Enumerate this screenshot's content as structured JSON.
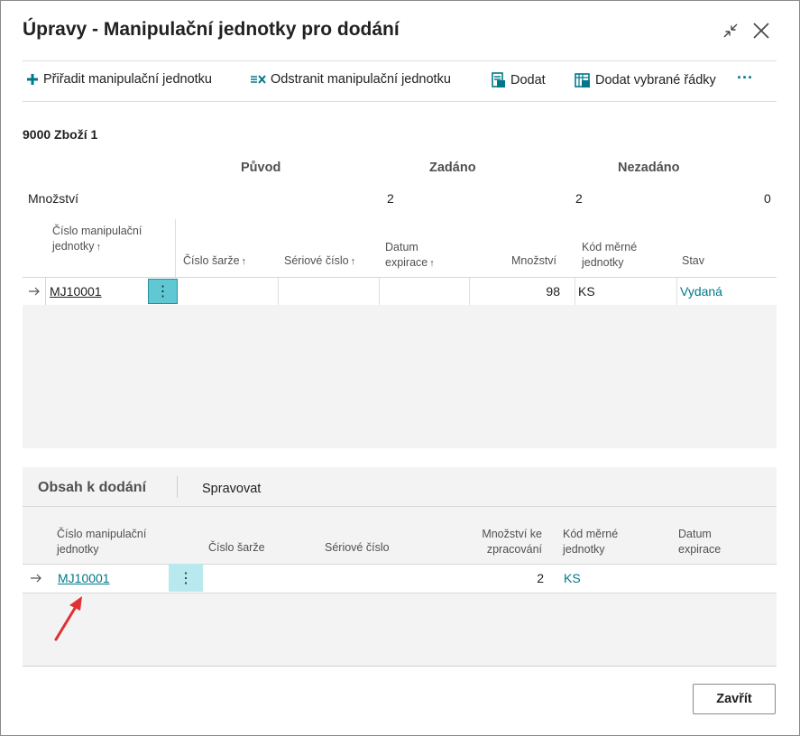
{
  "dialog": {
    "title": "Úpravy - Manipulační jednotky pro dodání"
  },
  "actions": {
    "assign": "Přiřadit manipulační jednotku",
    "remove": "Odstranit manipulační jednotku",
    "deliver": "Dodat",
    "deliver_selected": "Dodat vybrané řádky",
    "more": "···"
  },
  "item_header": "9000 Zboží 1",
  "summary": {
    "headers": [
      "Původ",
      "Zadáno",
      "Nezadáno"
    ],
    "row_label": "Množství",
    "values": [
      "2",
      "2",
      "0"
    ]
  },
  "grid1": {
    "columns": [
      "Číslo manipulační jednotky",
      "Číslo šarže",
      "Sériové číslo",
      "Datum expirace",
      "Množství",
      "Kód měrné jednotky",
      "Stav"
    ],
    "sort_arrow": "↑",
    "rows": [
      {
        "number": "MJ10001",
        "lot": "",
        "serial": "",
        "expiration": "",
        "quantity": "98",
        "uom": "KS",
        "status": "Vydaná"
      }
    ]
  },
  "part": {
    "tab_active": "Obsah k dodání",
    "tab_manage": "Spravovat",
    "columns": [
      "Číslo manipulační jednotky",
      "Číslo šarže",
      "Sériové číslo",
      "Množství ke zpracování",
      "Kód měrné jednotky",
      "Datum expirace"
    ],
    "rows": [
      {
        "number": "MJ10001",
        "lot": "",
        "serial": "",
        "qty": "2",
        "uom": "KS",
        "expiration": ""
      }
    ]
  },
  "buttons": {
    "close": "Zavřít"
  },
  "colors": {
    "accent": "#00788a",
    "teal_highlight": "#5fc8d2",
    "annotation": "#e03030"
  }
}
